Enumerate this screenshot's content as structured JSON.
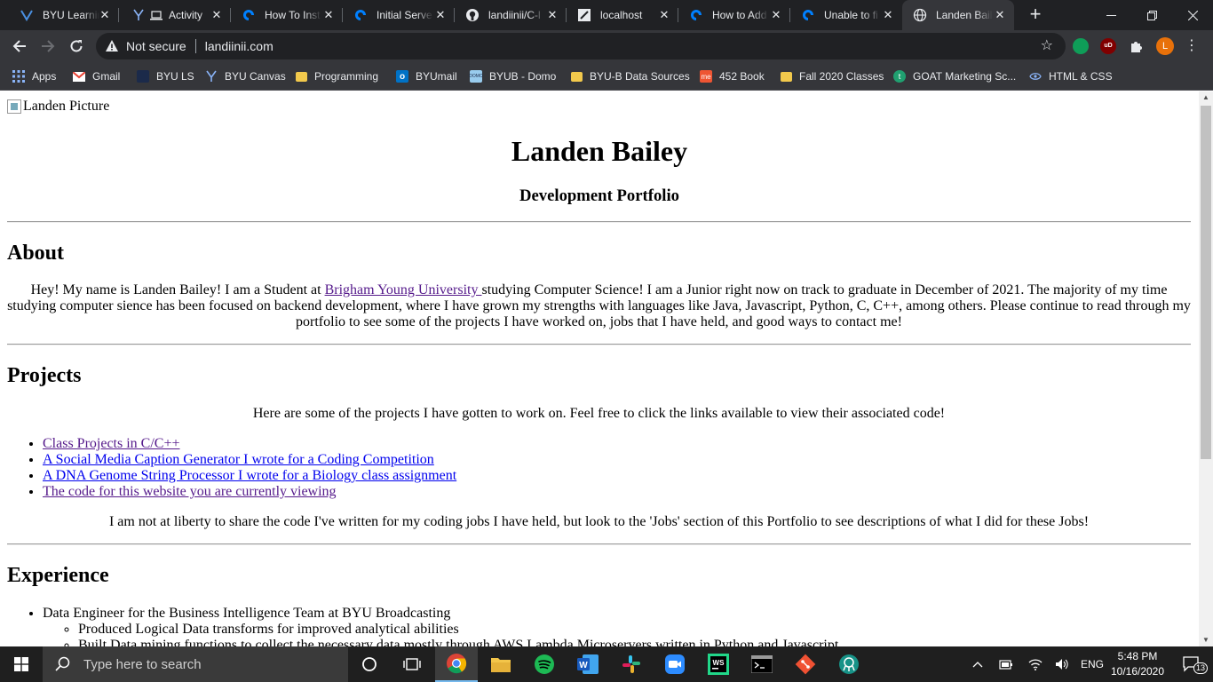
{
  "browser": {
    "tabs": [
      {
        "title": "BYU Learnin",
        "icon": "byu-learning-icon",
        "active": false
      },
      {
        "title": "Activity",
        "icon": "activity-icon",
        "active": false
      },
      {
        "title": "How To Inst",
        "icon": "digitalocean-icon",
        "active": false
      },
      {
        "title": "Initial Serve",
        "icon": "digitalocean-icon",
        "active": false
      },
      {
        "title": "landiinii/C-l",
        "icon": "github-icon",
        "active": false
      },
      {
        "title": "localhost",
        "icon": "localhost-icon",
        "active": false
      },
      {
        "title": "How to Add",
        "icon": "digitalocean-icon",
        "active": false
      },
      {
        "title": "Unable to fi",
        "icon": "digitalocean-icon",
        "active": false
      },
      {
        "title": "Landen Bail",
        "icon": "globe-icon",
        "active": true
      }
    ],
    "security_label": "Not secure",
    "url": "landiinii.com",
    "profile_initial": "L",
    "bookmarks": [
      {
        "label": "Apps",
        "icon": "apps-grid-icon"
      },
      {
        "label": "Gmail",
        "icon": "gmail-icon"
      },
      {
        "label": "BYU LS",
        "icon": "byu-ls-icon"
      },
      {
        "label": "BYU Canvas",
        "icon": "canvas-icon"
      },
      {
        "label": "Programming",
        "icon": "folder-icon"
      },
      {
        "label": "BYUmail",
        "icon": "outlook-icon"
      },
      {
        "label": "BYUB - Domo",
        "icon": "domo-icon"
      },
      {
        "label": "BYU-B Data Sources",
        "icon": "folder-icon"
      },
      {
        "label": "452 Book",
        "icon": "book-icon"
      },
      {
        "label": "Fall 2020 Classes",
        "icon": "folder-icon"
      },
      {
        "label": "GOAT Marketing Sc...",
        "icon": "goat-icon"
      },
      {
        "label": "HTML & CSS",
        "icon": "html-css-icon"
      }
    ]
  },
  "page": {
    "image_alt": "Landen Picture",
    "name": "Landen Bailey",
    "subtitle": "Development Portfolio",
    "about": {
      "heading": "About",
      "text_before": "Hey! My name is Landen Bailey! I am a Student at ",
      "link": "Brigham Young University ",
      "text_after": "studying Computer Science! I am a Junior right now on track to graduate in December of 2021. The majority of my time studying computer sience has been focused on backend development, where I have grown my strengths with languages like Java, Javascript, Python, C, C++, among others. Please continue to read through my portfolio to see some of the projects I have worked on, jobs that I have held, and good ways to contact me!"
    },
    "projects": {
      "heading": "Projects",
      "intro": "Here are some of the projects I have gotten to work on. Feel free to click the links available to view their associated code!",
      "links": [
        {
          "label": "Class Projects in C/C++",
          "visited": true
        },
        {
          "label": "A Social Media Caption Generator I wrote for a Coding Competition",
          "visited": false
        },
        {
          "label": "A DNA Genome String Processor I wrote for a Biology class assignment",
          "visited": false
        },
        {
          "label": "The code for this website you are currently viewing",
          "visited": true
        }
      ],
      "note": "I am not at liberty to share the code I've written for my coding jobs I have held, but look to the 'Jobs' section of this Portfolio to see descriptions of what I did for these Jobs!"
    },
    "experience": {
      "heading": "Experience",
      "jobs": [
        {
          "title": "Data Engineer for the Business Intelligence Team at BYU Broadcasting",
          "duties": [
            "Produced Logical Data transforms for improved analytical abilities",
            "Built Data mining functions to collect the necessary data mostly through AWS Lambda Microservers written in Python and Javascript"
          ]
        }
      ]
    }
  },
  "taskbar": {
    "search_placeholder": "Type here to search",
    "apps": [
      "cortana-icon",
      "task-view-icon",
      "chrome-icon",
      "file-explorer-icon",
      "spotify-icon",
      "word-icon",
      "slack-icon",
      "zoom-icon",
      "webstorm-icon",
      "terminal-icon",
      "git-icon",
      "gitkraken-icon"
    ],
    "language": "ENG",
    "time": "5:48 PM",
    "date": "10/16/2020",
    "notification_count": "13"
  },
  "colors": {
    "chrome_dark": "#202124",
    "toolbar": "#35363a",
    "link": "#0000ee",
    "visited_link": "#551a8b",
    "taskbar": "#1f1f1f",
    "profile": "#e8710a"
  }
}
